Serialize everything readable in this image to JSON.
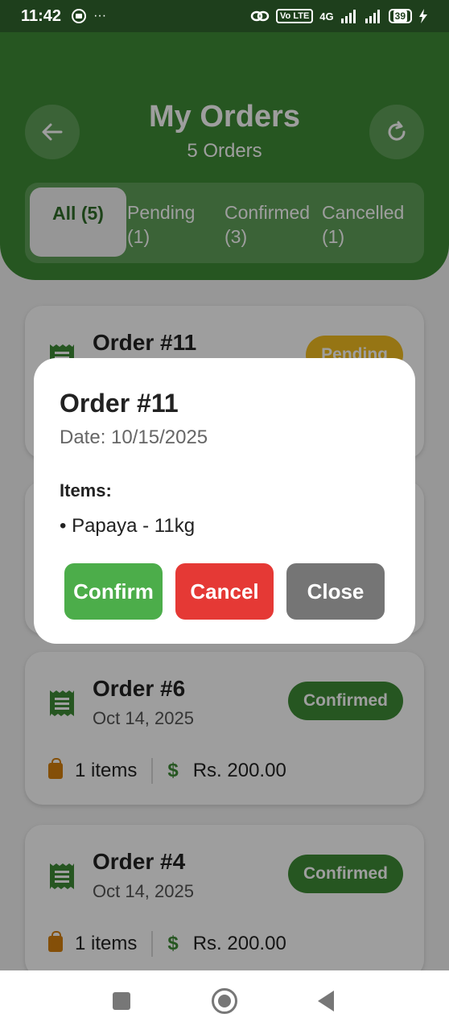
{
  "status_bar": {
    "time": "11:42",
    "left_icons": [
      "record-icon",
      "more-icon"
    ],
    "dots": "···",
    "volte": "Vo LTE",
    "network": "4G",
    "battery": "39"
  },
  "header": {
    "title": "My Orders",
    "subtitle": "5 Orders",
    "back_icon": "arrow-left-icon",
    "refresh_icon": "refresh-icon"
  },
  "tabs": [
    {
      "label": "All (5)",
      "active": true
    },
    {
      "label": "Pending\n(1)",
      "active": false
    },
    {
      "label": "Confirmed\n(3)",
      "active": false
    },
    {
      "label": "Cancelled\n(1)",
      "active": false
    }
  ],
  "orders": [
    {
      "title": "Order #11",
      "date": "",
      "status": "Pending",
      "items": "",
      "amount": ""
    },
    {
      "title": "Order #6",
      "date": "Oct 14, 2025",
      "status": "Confirmed",
      "items": "1 items",
      "amount": "Rs. 200.00"
    },
    {
      "title": "Order #4",
      "date": "Oct 14, 2025",
      "status": "Confirmed",
      "items": "1 items",
      "amount": "Rs. 200.00"
    }
  ],
  "currency_symbol": "$",
  "modal": {
    "title": "Order #11",
    "date": "Date: 10/15/2025",
    "items_label": "Items:",
    "items": [
      "• Papaya - 11kg"
    ],
    "confirm_label": "Confirm",
    "cancel_label": "Cancel",
    "close_label": "Close"
  },
  "colors": {
    "primary": "#3e8c36",
    "pending": "#f3bd21",
    "cancel": "#e53935",
    "close": "#757575"
  }
}
